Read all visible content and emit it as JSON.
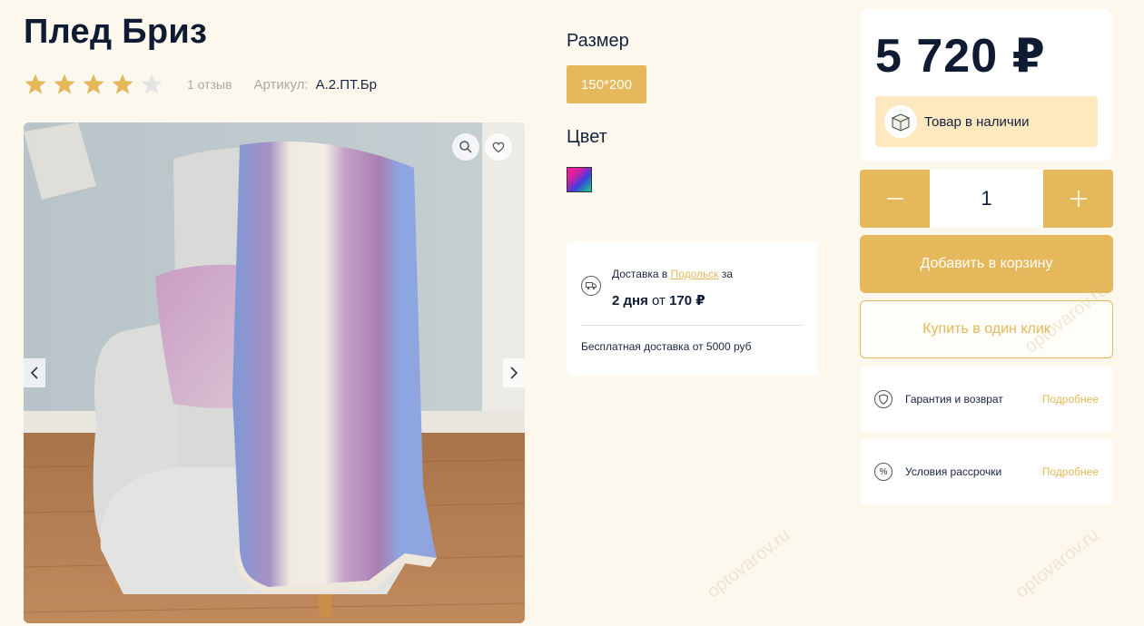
{
  "product": {
    "title": "Плед Бриз",
    "rating": 4,
    "rating_max": 5,
    "reviews": "1 отзыв",
    "article_label": "Артикул:",
    "article_value": "А.2.ПТ.Бр"
  },
  "options": {
    "size_label": "Размер",
    "size_value": "150*200",
    "color_label": "Цвет"
  },
  "delivery": {
    "line_prefix": "Доставка в",
    "city": "Подольск",
    "line_suffix": "за",
    "days": "2 дня",
    "from": "от",
    "price": "170 ₽",
    "free": "Бесплатная доставка от 5000 руб"
  },
  "purchase": {
    "price": "5 720 ₽",
    "stock": "Товар в наличии",
    "quantity": "1",
    "add_to_cart": "Добавить в корзину",
    "one_click": "Купить в один клик"
  },
  "info": [
    {
      "label": "Гарантия и возврат",
      "link": "Подробнее"
    },
    {
      "label": "Условия рассрочки",
      "link": "Подробнее"
    }
  ],
  "watermark": "optovarov.ru",
  "colors": {
    "accent": "#e6b85c",
    "stock_bg": "#fde8bf",
    "page_bg": "#fdf8ee",
    "text": "#14213d"
  }
}
